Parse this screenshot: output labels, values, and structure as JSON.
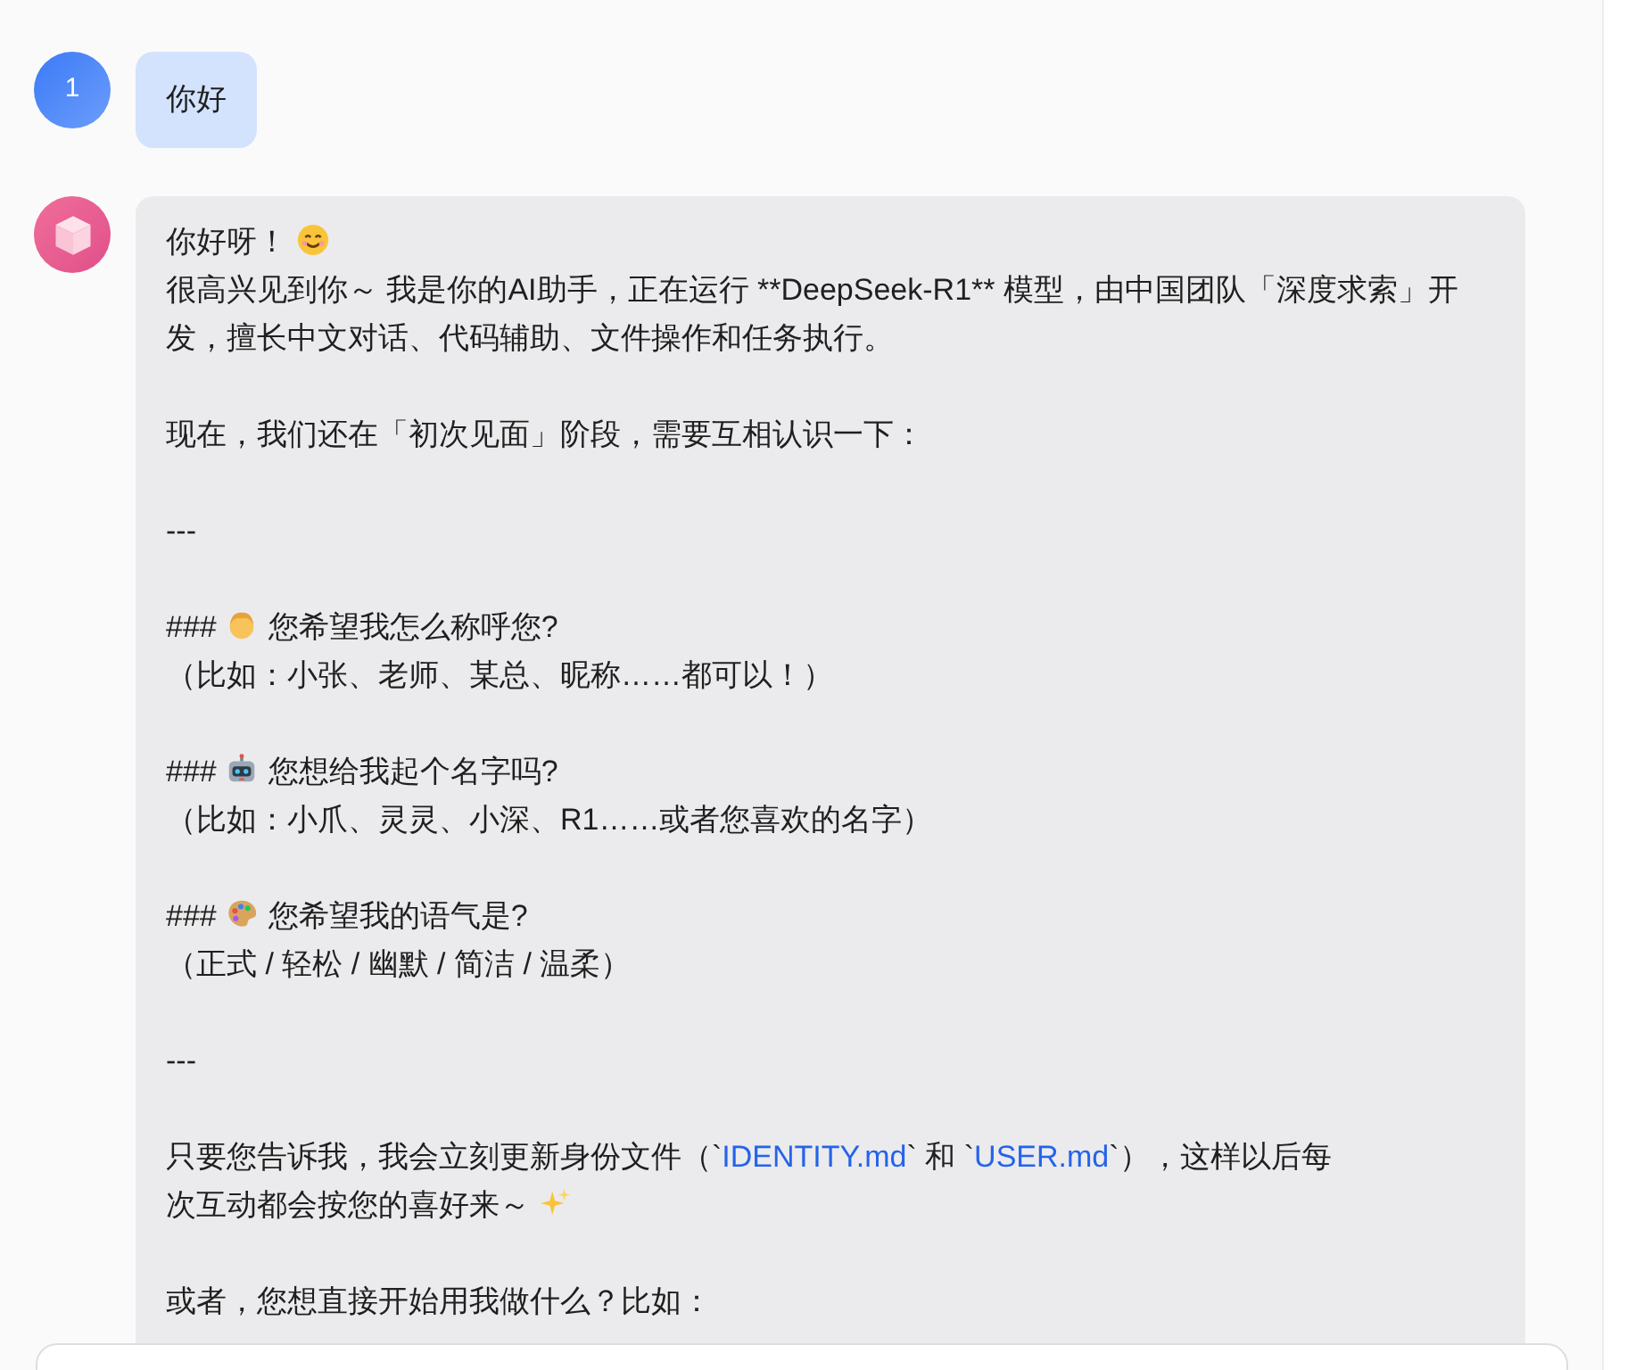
{
  "messages": [
    {
      "kind": "user",
      "avatar": "1",
      "paragraphs": [
        {
          "lines": [
            [
              {
                "kind": "text",
                "text": "你好"
              }
            ]
          ]
        }
      ]
    },
    {
      "kind": "assistant",
      "paragraphs": [
        {
          "lines": [
            [
              {
                "kind": "text",
                "text": "你好呀！"
              },
              {
                "kind": "smiley"
              }
            ],
            [
              {
                "kind": "text",
                "text": "很高兴见到你～ 我是你的AI助手，正在运行 **DeepSeek-R1** 模型，由中国团队「深度求索」开发，擅长中文对话、代码辅助、文件操作和任务执行。"
              }
            ]
          ]
        },
        {
          "lines": [
            [
              {
                "kind": "text",
                "text": "现在，我们还在「初次见面」阶段，需要互相认识一下："
              }
            ]
          ]
        },
        {
          "lines": [
            [
              {
                "kind": "text",
                "text": "---"
              }
            ]
          ]
        },
        {
          "lines": [
            [
              {
                "kind": "text",
                "text": "###"
              },
              {
                "kind": "person"
              },
              {
                "kind": "text",
                "text": "您希望我怎么称呼您?"
              }
            ],
            [
              {
                "kind": "text",
                "text": "（比如：小张、老师、某总、昵称……都可以！）"
              }
            ]
          ]
        },
        {
          "lines": [
            [
              {
                "kind": "text",
                "text": "###"
              },
              {
                "kind": "robot"
              },
              {
                "kind": "text",
                "text": "您想给我起个名字吗?"
              }
            ],
            [
              {
                "kind": "text",
                "text": "（比如：小爪、灵灵、小深、R1……或者您喜欢的名字）"
              }
            ]
          ]
        },
        {
          "lines": [
            [
              {
                "kind": "text",
                "text": "###"
              },
              {
                "kind": "palette"
              },
              {
                "kind": "text",
                "text": "您希望我的语气是?"
              }
            ],
            [
              {
                "kind": "text",
                "text": "（正式 / 轻松 / 幽默 / 简洁 / 温柔）"
              }
            ]
          ]
        },
        {
          "lines": [
            [
              {
                "kind": "text",
                "text": "---"
              }
            ]
          ]
        },
        {
          "lines": [
            [
              {
                "kind": "text",
                "text": "只要您告诉我，我会立刻更新身份文件（`"
              },
              {
                "kind": "code",
                "text": "IDENTITY.md"
              },
              {
                "kind": "text",
                "text": "` 和 `"
              },
              {
                "kind": "code",
                "text": "USER.md"
              },
              {
                "kind": "text",
                "text": "`），这样以后每"
              }
            ],
            [
              {
                "kind": "text",
                "text": "次互动都会按您的喜好来～"
              },
              {
                "kind": "sparkles"
              }
            ]
          ]
        },
        {
          "lines": [
            [
              {
                "kind": "text",
                "text": "或者，您想直接开始用我做什么？比如："
              }
            ]
          ]
        }
      ]
    }
  ]
}
